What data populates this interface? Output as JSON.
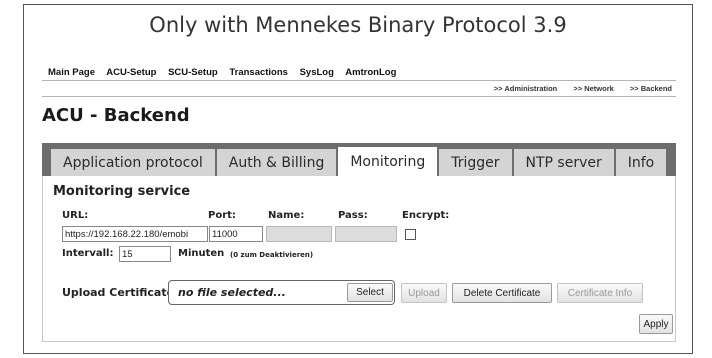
{
  "caption": "Only with Mennekes Binary Protocol 3.9",
  "topnav": [
    "Main Page",
    "ACU-Setup",
    "SCU-Setup",
    "Transactions",
    "SysLog",
    "AmtronLog"
  ],
  "breadcrumbs": [
    ">> Administration",
    ">> Network",
    ">> Backend"
  ],
  "page_title": "ACU - Backend",
  "tabs": [
    "Application protocol",
    "Auth & Billing",
    "Monitoring",
    "Trigger",
    "NTP server",
    "Info"
  ],
  "active_tab": "Monitoring",
  "section_title": "Monitoring service",
  "form": {
    "url_label": "URL:",
    "url_value": "https://192.168.22.180/emobi",
    "port_label": "Port:",
    "port_value": "11000",
    "name_label": "Name:",
    "name_value": "",
    "pass_label": "Pass:",
    "pass_value": "",
    "encrypt_label": "Encrypt:",
    "encrypt_checked": false,
    "interval_label": "Intervall:",
    "interval_value": "15",
    "minutes_label": "Minuten",
    "minutes_hint": "(0 zum Deaktivieren)"
  },
  "upload": {
    "label": "Upload Certificate:",
    "file_text": "no file selected...",
    "select_label": "Select",
    "upload_label": "Upload",
    "delete_label": "Delete Certificate",
    "info_label": "Certificate Info"
  },
  "apply_label": "Apply"
}
